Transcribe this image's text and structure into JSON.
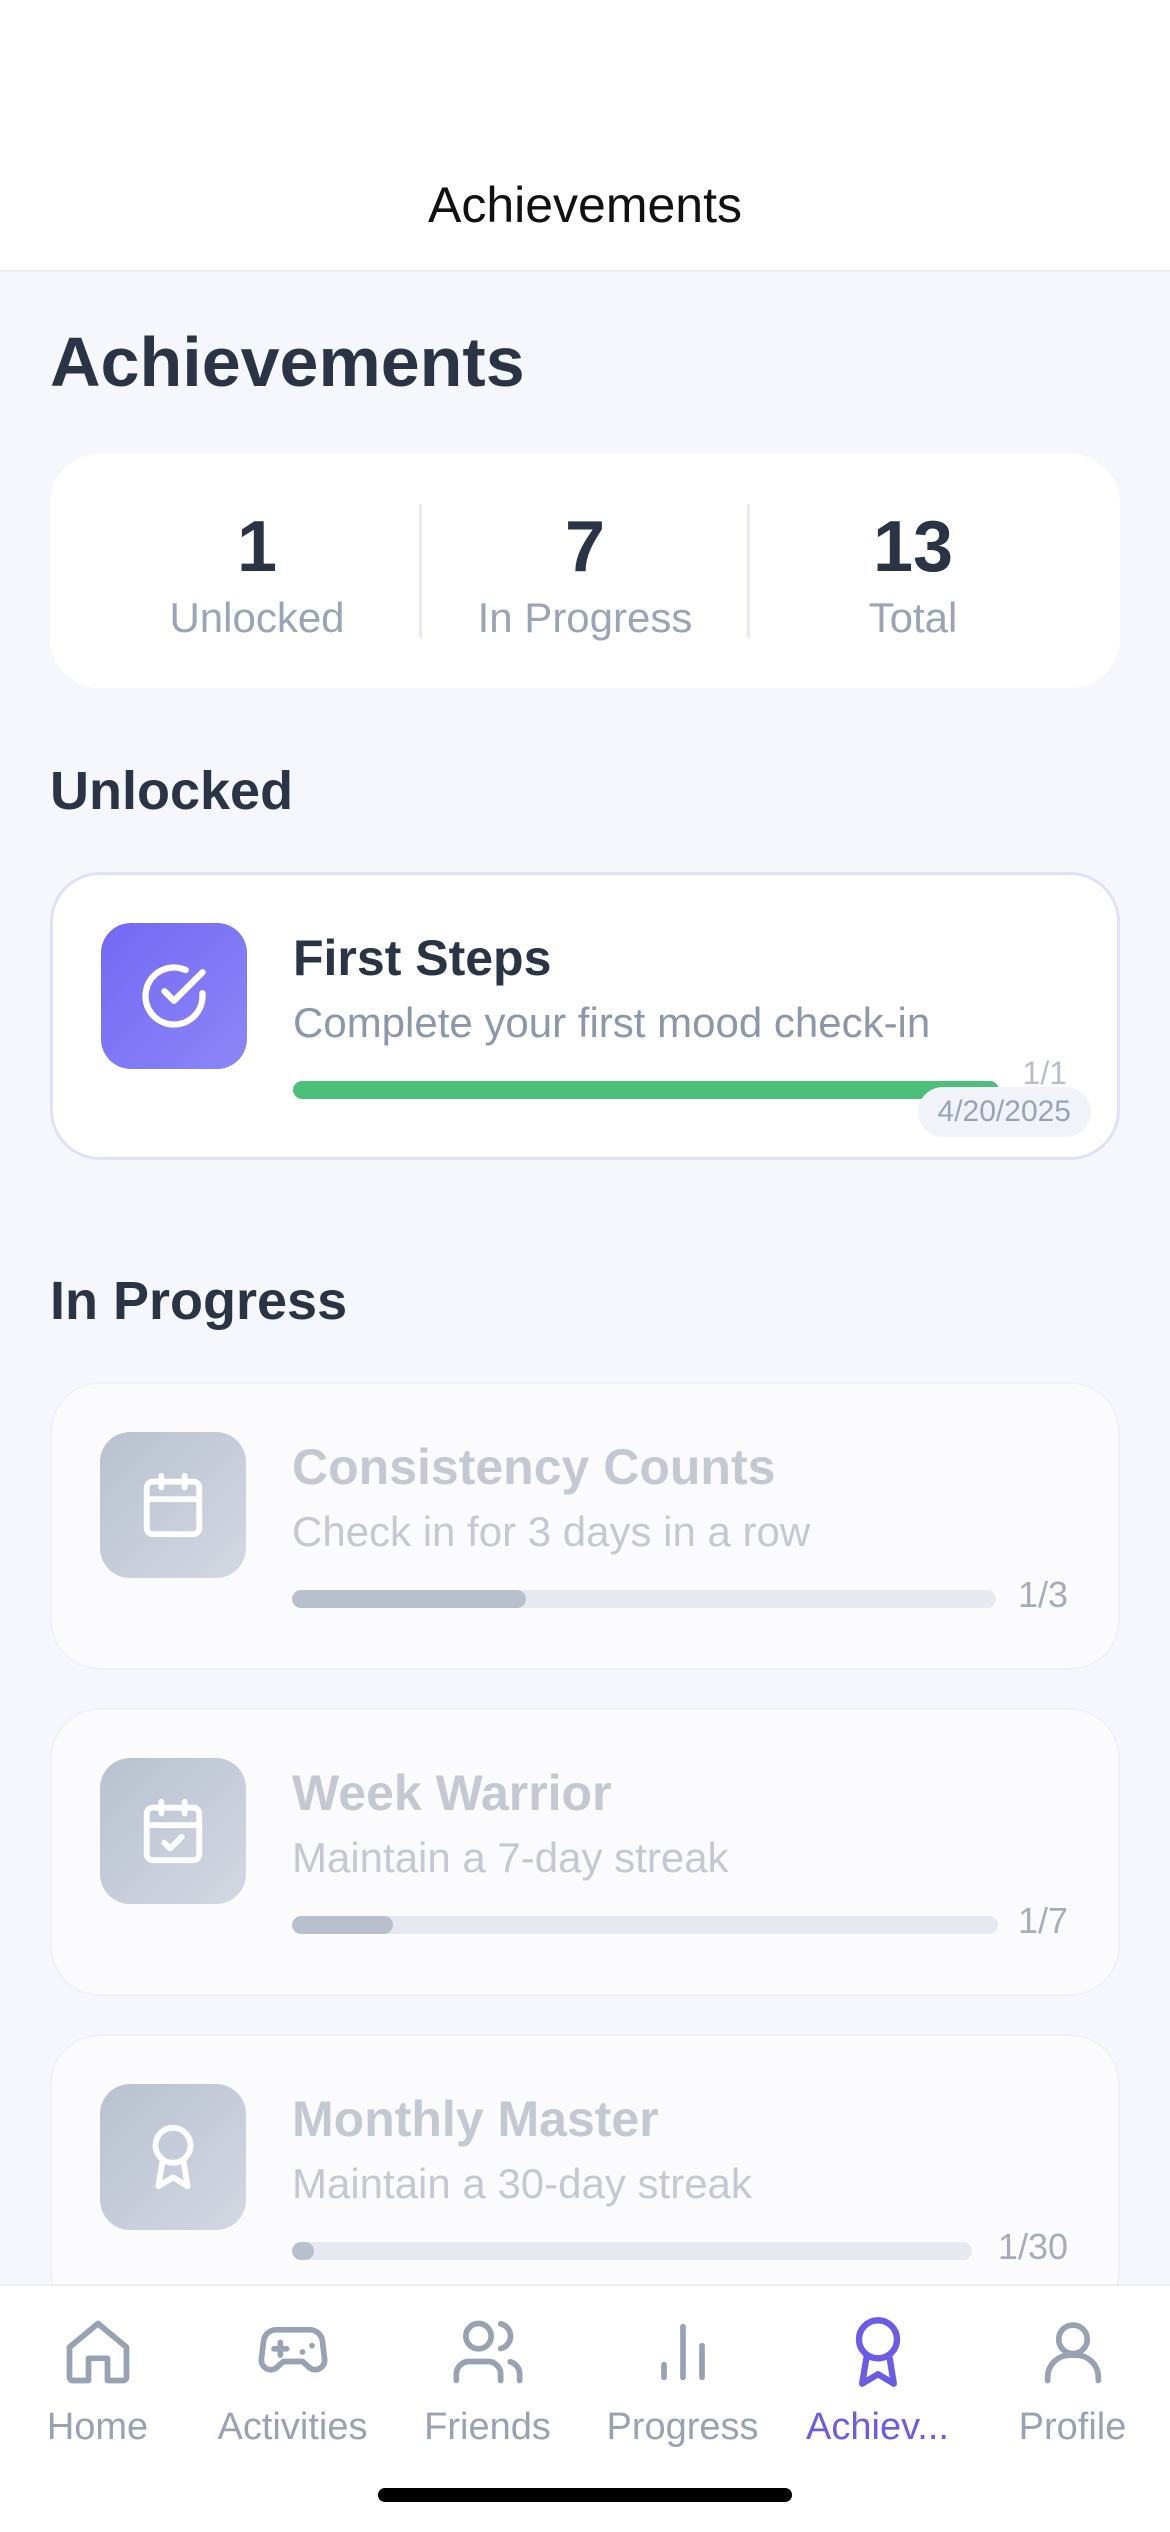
{
  "header": {
    "title": "Achievements"
  },
  "page": {
    "title": "Achievements"
  },
  "summary": {
    "unlocked": {
      "value": "1",
      "label": "Unlocked"
    },
    "in_progress": {
      "value": "7",
      "label": "In Progress"
    },
    "total": {
      "value": "13",
      "label": "Total"
    }
  },
  "sections": {
    "unlocked": "Unlocked",
    "in_progress": "In Progress"
  },
  "unlocked_items": [
    {
      "name": "First Steps",
      "description": "Complete your first mood check-in",
      "count": "1/1",
      "date": "4/20/2025",
      "progress": 1.0,
      "icon": "check-circle-icon"
    }
  ],
  "progress_items": [
    {
      "name": "Consistency Counts",
      "description": "Check in for 3 days in a row",
      "count": "1/3",
      "progress": 0.333,
      "icon": "calendar-icon"
    },
    {
      "name": "Week Warrior",
      "description": "Maintain a 7-day streak",
      "count": "1/7",
      "progress": 0.143,
      "icon": "calendar-check-icon"
    },
    {
      "name": "Monthly Master",
      "description": "Maintain a 30-day streak",
      "count": "1/30",
      "progress": 0.033,
      "icon": "award-icon"
    }
  ],
  "colors": {
    "accent": "#6B5CE7",
    "progress_complete": "#4CBF7A",
    "progress_partial": "#B8C0CE"
  },
  "tabs": [
    {
      "label": "Home",
      "icon": "home-icon",
      "active": false
    },
    {
      "label": "Activities",
      "icon": "gamepad-icon",
      "active": false
    },
    {
      "label": "Friends",
      "icon": "users-icon",
      "active": false
    },
    {
      "label": "Progress",
      "icon": "bar-chart-icon",
      "active": false
    },
    {
      "label": "Achiev...",
      "icon": "award-icon",
      "active": true
    },
    {
      "label": "Profile",
      "icon": "user-icon",
      "active": false
    }
  ]
}
